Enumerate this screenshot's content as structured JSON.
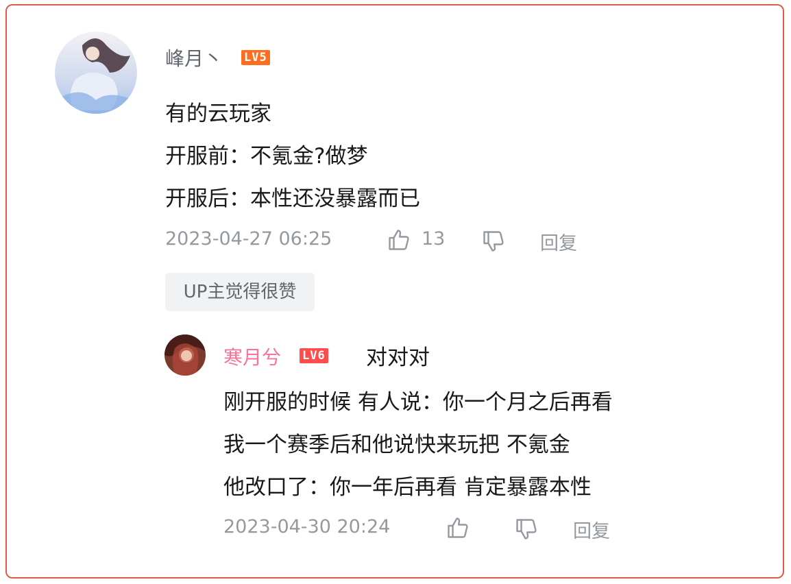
{
  "comment": {
    "username": "峰月丶",
    "level": "LV5",
    "lines": [
      "有的云玩家",
      "开服前：不氪金?做梦",
      "开服后：本性还没暴露而已"
    ],
    "timestamp": "2023-04-27 06:25",
    "likes": "13",
    "reply_label": "回复",
    "up_tag": "UP主觉得很赞",
    "icons": {
      "like": "thumbs-up-icon",
      "dislike": "thumbs-down-icon"
    }
  },
  "reply": {
    "username": "寒月兮",
    "level": "LV6",
    "first_line": "对对对",
    "lines": [
      "刚开服的时候 有人说：你一个月之后再看",
      "我一个赛季后和他说快来玩把 不氪金",
      "他改口了：你一年后再看 肯定暴露本性"
    ],
    "timestamp": "2023-04-30 20:24",
    "reply_label": "回复"
  },
  "colors": {
    "border": "#e05a4a",
    "username_pink": "#fb7299",
    "level_badge": "#ff6e1f",
    "meta_gray": "#9499a0"
  }
}
